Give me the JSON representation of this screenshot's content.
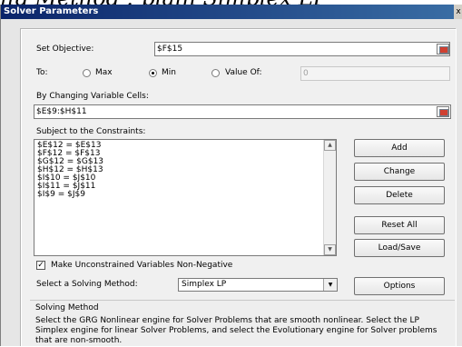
{
  "behind_text": "ng Method : plain Simplex LP",
  "window": {
    "title": "Solver Parameters",
    "close_label": "x"
  },
  "objective": {
    "label": "Set Objective:",
    "value": "$F$15"
  },
  "to": {
    "label": "To:",
    "options": [
      {
        "label": "Max",
        "selected": false
      },
      {
        "label": "Min",
        "selected": true
      },
      {
        "label": "Value Of:",
        "selected": false
      }
    ],
    "value_of": "0"
  },
  "changing": {
    "label": "By Changing Variable Cells:",
    "value": "$E$9:$H$11"
  },
  "constraints": {
    "label": "Subject to the Constraints:",
    "items": [
      "$E$12 = $E$13",
      "$F$12 = $F$13",
      "$G$12 = $G$13",
      "$H$12 = $H$13",
      "$I$10 = $J$10",
      "$I$11 = $J$11",
      "$I$9 = $J$9"
    ]
  },
  "buttons": {
    "add": "Add",
    "change": "Change",
    "delete": "Delete",
    "reset_all": "Reset All",
    "load_save": "Load/Save",
    "options": "Options"
  },
  "nonneg": {
    "label": "Make Unconstrained Variables Non-Negative",
    "checked": true,
    "mark": "✓"
  },
  "method": {
    "label": "Select a Solving Method:",
    "value": "Simplex LP"
  },
  "solving_method": {
    "title": "Solving Method",
    "description": "Select the GRG Nonlinear engine for Solver Problems that are smooth nonlinear. Select the LP Simplex engine for linear Solver Problems, and select the Evolutionary engine for Solver problems that are non-smooth."
  }
}
